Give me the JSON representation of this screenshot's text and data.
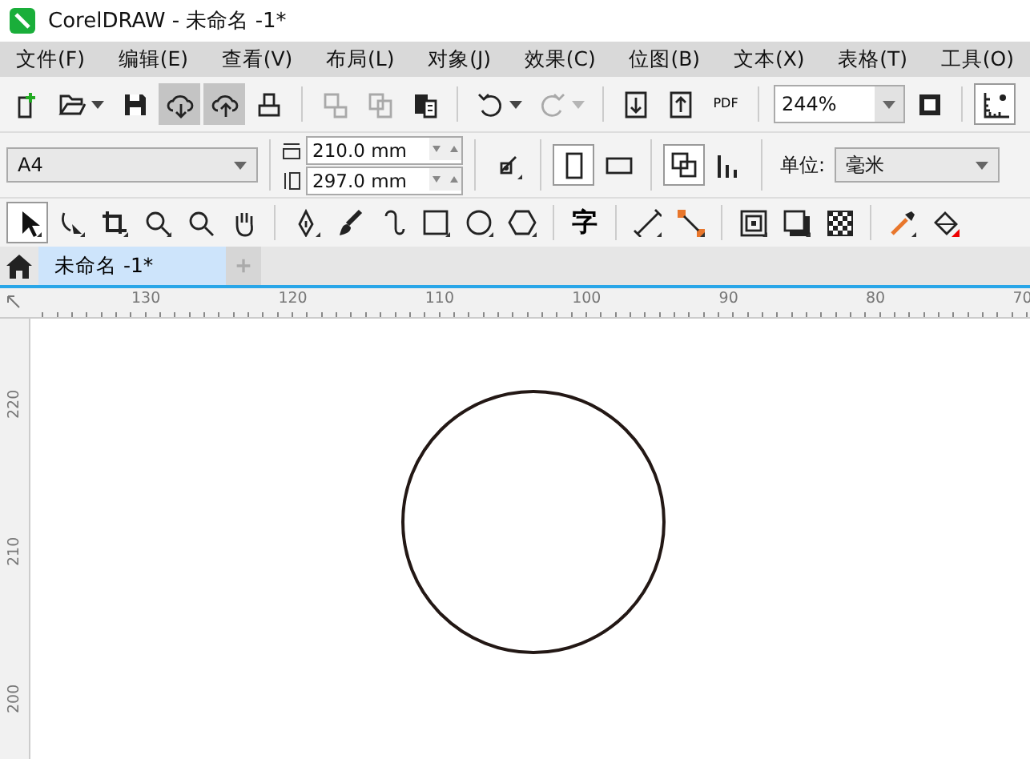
{
  "window": {
    "title": "CorelDRAW - 未命名 -1*"
  },
  "menu": [
    "文件(F)",
    "编辑(E)",
    "查看(V)",
    "布局(L)",
    "对象(J)",
    "效果(C)",
    "位图(B)",
    "文本(X)",
    "表格(T)",
    "工具(O)"
  ],
  "toolbar": [
    {
      "kind": "new",
      "disabled": false,
      "active": false
    },
    {
      "kind": "open",
      "disabled": false,
      "active": false
    },
    {
      "kind": "save",
      "disabled": false,
      "active": false
    },
    {
      "kind": "download",
      "disabled": false,
      "active": true
    },
    {
      "kind": "upload",
      "disabled": false,
      "active": true
    },
    {
      "kind": "print",
      "disabled": false,
      "active": false
    },
    {
      "kind": "cut",
      "disabled": true,
      "active": false
    },
    {
      "kind": "copy",
      "disabled": true,
      "active": false
    },
    {
      "kind": "paste",
      "disabled": false,
      "active": false
    },
    {
      "kind": "undo",
      "disabled": false,
      "active": false
    },
    {
      "kind": "redo",
      "disabled": true,
      "active": false
    },
    {
      "kind": "import",
      "disabled": false,
      "active": false
    },
    {
      "kind": "export",
      "disabled": false,
      "active": false
    }
  ],
  "pdf_button": {
    "label": "PDF"
  },
  "zoom": {
    "value": "244%"
  },
  "property_bar": {
    "page_size": "A4",
    "width": "210.0 mm",
    "height": "297.0 mm",
    "unit_label": "单位:",
    "unit": "毫米",
    "orientation": [
      {
        "kind": "portrait",
        "selected": true
      },
      {
        "kind": "landscape",
        "selected": false
      }
    ]
  },
  "toolbox": [
    {
      "kind": "pick",
      "selected": true
    },
    {
      "kind": "shape",
      "selected": false
    },
    {
      "kind": "crop",
      "selected": false
    },
    {
      "kind": "zoom",
      "selected": false
    },
    {
      "kind": "zoomout",
      "selected": false
    },
    {
      "kind": "pan",
      "selected": false
    },
    {
      "kind": "pen",
      "selected": false
    },
    {
      "kind": "brush",
      "selected": false
    },
    {
      "kind": "curve",
      "selected": false
    },
    {
      "kind": "rect",
      "selected": false
    },
    {
      "kind": "ellipse",
      "selected": false
    },
    {
      "kind": "polygon",
      "selected": false
    },
    {
      "kind": "text",
      "label": "字",
      "selected": false
    },
    {
      "kind": "dimension",
      "selected": false
    },
    {
      "kind": "connector",
      "selected": false
    },
    {
      "kind": "contour",
      "selected": false
    },
    {
      "kind": "shadow",
      "selected": false
    },
    {
      "kind": "transparency",
      "selected": false
    },
    {
      "kind": "eyedropper",
      "selected": false
    },
    {
      "kind": "fill",
      "selected": false
    }
  ],
  "tabs": [
    {
      "label": "未命名 -1*",
      "selected": true
    }
  ],
  "ruler": {
    "horizontal": [
      "130",
      "120",
      "110",
      "100",
      "90",
      "80",
      "70"
    ],
    "vertical": [
      "220",
      "210",
      "200"
    ]
  }
}
